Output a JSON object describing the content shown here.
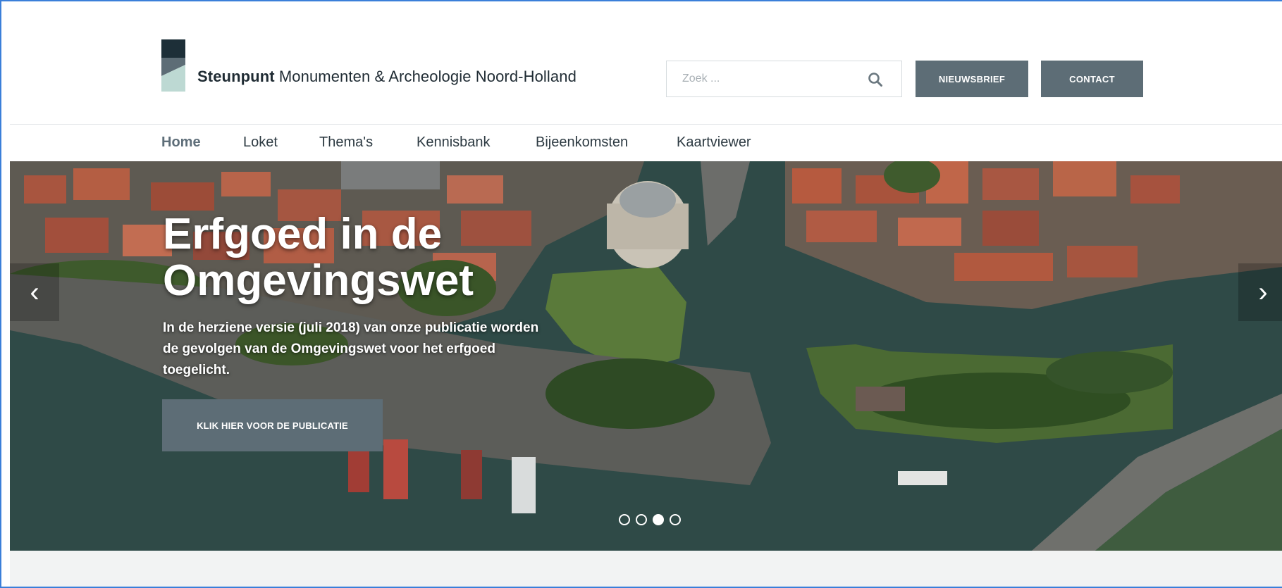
{
  "header": {
    "brand_bold": "Steunpunt",
    "brand_rest": " Monumenten & Archeologie Noord-Holland",
    "search_placeholder": "Zoek ...",
    "newsletter_button": "NIEUWSBRIEF",
    "contact_button": "CONTACT",
    "logo_colors": [
      "#1d2f38",
      "#5d6d76",
      "#bdd9d3"
    ]
  },
  "nav": {
    "items": [
      {
        "label": "Home",
        "active": true
      },
      {
        "label": "Loket",
        "active": false
      },
      {
        "label": "Thema's",
        "active": false
      },
      {
        "label": "Kennisbank",
        "active": false
      },
      {
        "label": "Bijeenkomsten",
        "active": false
      },
      {
        "label": "Kaartviewer",
        "active": false
      }
    ]
  },
  "hero": {
    "title_line1": "Erfgoed in de",
    "title_line2": "Omgevingswet",
    "text_line1": "In de herziene versie (juli 2018) van onze publicatie worden",
    "text_line2": "de gevolgen van de Omgevingswet voor het erfgoed",
    "text_line3": "toegelicht.",
    "cta_label": "KLIK HIER VOOR DE PUBLICATIE",
    "prev_arrow": "‹",
    "next_arrow": "›",
    "slide_count": 4,
    "active_slide": 3
  },
  "colors": {
    "accent": "#5d6d76",
    "nav_active": "#5e6e79",
    "frame": "#3b7fd9"
  }
}
